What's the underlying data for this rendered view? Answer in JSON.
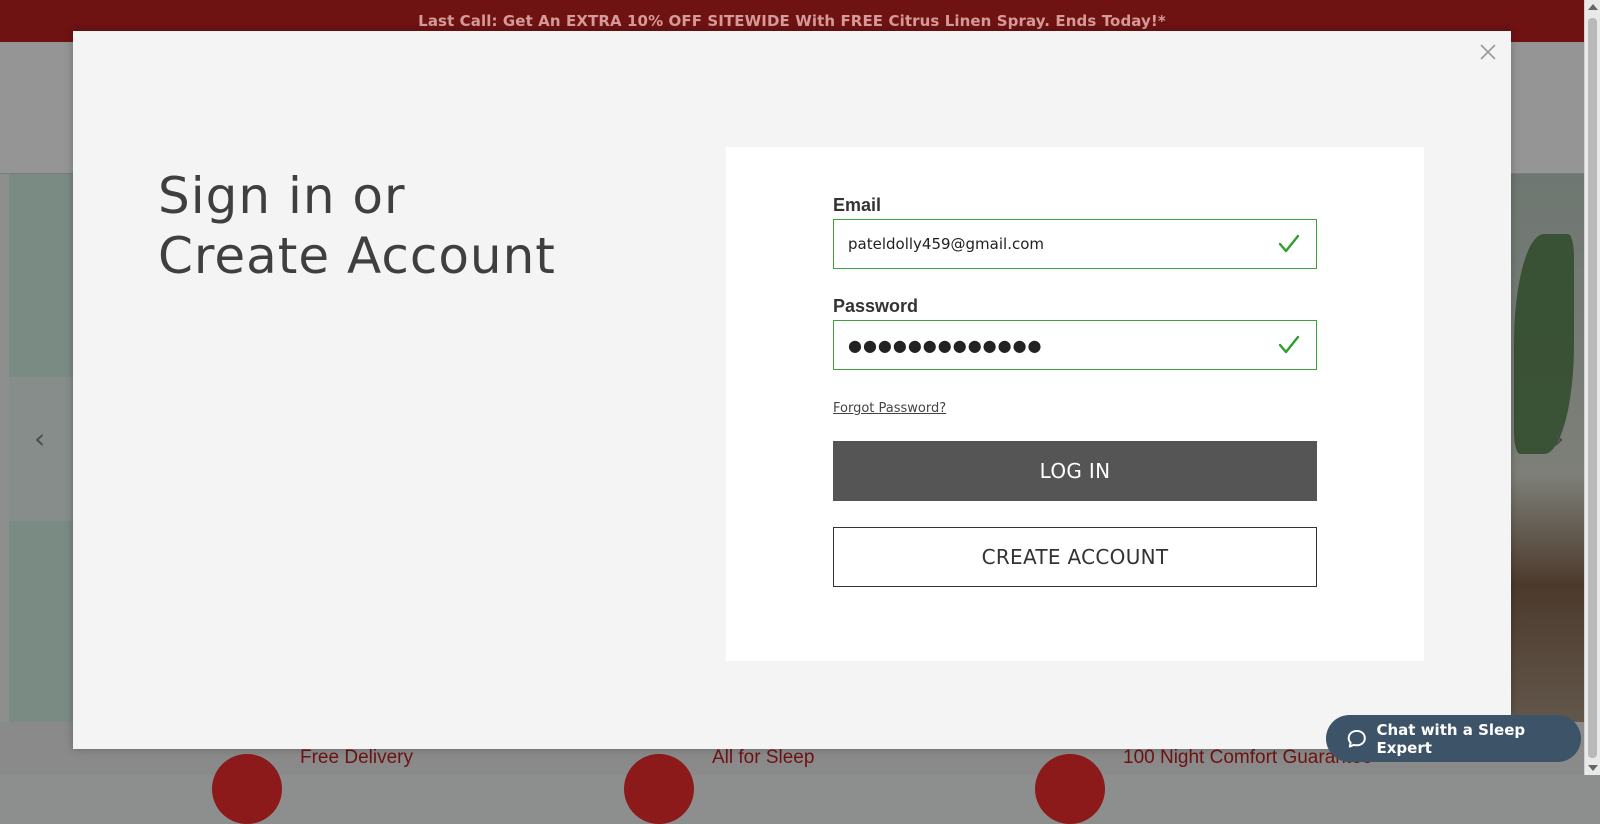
{
  "promo": {
    "text": "Last Call: Get An EXTRA 10% OFF SITEWIDE With FREE Citrus Linen Spray. Ends Today!*"
  },
  "background": {
    "prev_arrow": "‹",
    "next_arrow": "›",
    "features": [
      {
        "label": "Free Delivery"
      },
      {
        "label": "All for Sleep"
      },
      {
        "label": "100 Night Comfort Guarantee"
      }
    ]
  },
  "modal": {
    "title_line1": "Sign in or",
    "title_line2": "Create Account",
    "close_icon": "close-icon",
    "form": {
      "email_label": "Email",
      "email_value": "pateldolly459@gmail.com",
      "password_label": "Password",
      "password_value": "●●●●●●●●●●●●●",
      "valid_icon": "check-icon",
      "valid_color": "#2e9e2e",
      "forgot_link": "Forgot Password?",
      "login_button": "LOG IN",
      "create_button": "CREATE ACCOUNT"
    }
  },
  "chat": {
    "label": "Chat with a Sleep Expert",
    "icon": "chat-bubble-icon",
    "color": "#3d5368"
  },
  "colors": {
    "promo_bg": "#6e1212",
    "login_bg": "#555555",
    "modal_bg": "#f4f4f4"
  }
}
